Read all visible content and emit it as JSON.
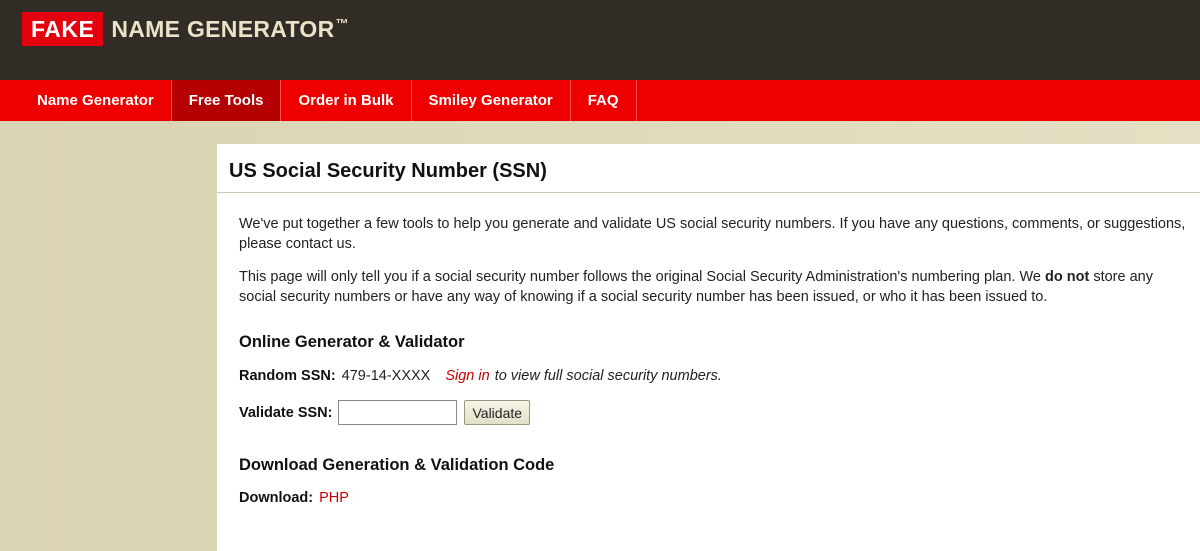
{
  "header": {
    "logo_fake": "FAKE",
    "logo_rest": "NAME GENERATOR",
    "logo_tm": "™"
  },
  "nav": {
    "items": [
      {
        "label": "Name Generator"
      },
      {
        "label": "Free Tools",
        "active": true
      },
      {
        "label": "Order in Bulk"
      },
      {
        "label": "Smiley Generator"
      },
      {
        "label": "FAQ"
      }
    ]
  },
  "page": {
    "title": "US Social Security Number (SSN)",
    "intro": "We've put together a few tools to help you generate and validate US social security numbers. If you have any questions, comments, or suggestions, please contact us.",
    "notice_before": "This page will only tell you if a social security number follows the original Social Security Administration's numbering plan. We ",
    "notice_bold": "do not",
    "notice_after": " store any social security numbers or have any way of knowing if a social security number has been issued, or who it has been issued to."
  },
  "generator": {
    "heading": "Online Generator & Validator",
    "random_label": "Random SSN:",
    "random_value": "479-14-XXXX",
    "signin_link": "Sign in",
    "signin_suffix": "to view full social security numbers.",
    "validate_label": "Validate SSN:",
    "validate_value": "",
    "validate_button": "Validate"
  },
  "download": {
    "heading": "Download Generation & Validation Code",
    "label": "Download:",
    "link": "PHP"
  },
  "colors": {
    "header_bg": "#312c26",
    "nav_bg": "#ee0000",
    "nav_active": "#b40000",
    "link": "#cc0000"
  }
}
